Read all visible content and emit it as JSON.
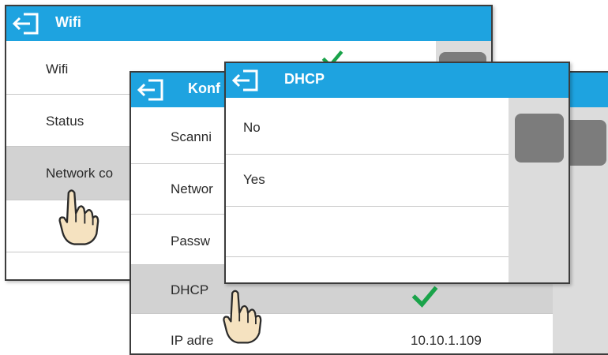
{
  "wifi_panel": {
    "title": "Wifi",
    "items": [
      {
        "label": "Wifi"
      },
      {
        "label": "Status"
      },
      {
        "label": "Network co"
      }
    ]
  },
  "config_panel": {
    "title": "Konf",
    "items": [
      {
        "label": "Scanni"
      },
      {
        "label": "Networ"
      },
      {
        "label": "Passw"
      },
      {
        "label": "DHCP"
      },
      {
        "label": "IP adre"
      }
    ],
    "ip_value": "10.10.1.109"
  },
  "dhcp_panel": {
    "title": "DHCP",
    "options": [
      {
        "label": "No"
      },
      {
        "label": "Yes"
      },
      {
        "label": ""
      },
      {
        "label": ""
      }
    ]
  },
  "colors": {
    "title_bar": "#1ea3e0",
    "check": "#1aa34a",
    "selected_row": "#d2d2d2"
  },
  "icons": [
    "back-arrow-icon",
    "checkmark-icon",
    "pointing-hand-icon"
  ]
}
